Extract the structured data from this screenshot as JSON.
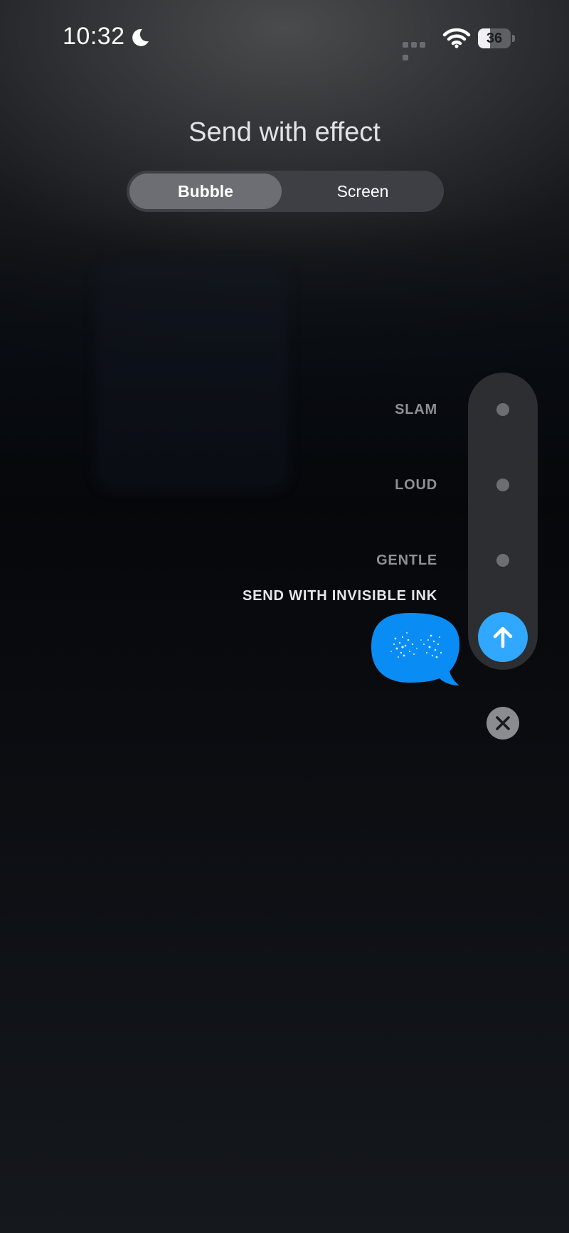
{
  "status_bar": {
    "time": "10:32",
    "focus_icon": "moon-icon",
    "battery": 36,
    "battery_label": "36"
  },
  "header": {
    "title": "Send with effect",
    "tabs": [
      {
        "label": "Bubble",
        "selected": true
      },
      {
        "label": "Screen",
        "selected": false
      }
    ]
  },
  "effects": {
    "slam": "SLAM",
    "loud": "LOUD",
    "gentle": "GENTLE",
    "invisible_ink": "SEND WITH INVISIBLE INK"
  },
  "colors": {
    "accent": "#31a8ff",
    "rail": "#2c2e32",
    "label_inactive": "#8e9094",
    "label_active": "#e4e6ea"
  },
  "icons": {
    "send": "arrow-up-icon",
    "close": "close-icon",
    "wifi": "wifi-icon",
    "cellular": "cellular-signal-icon"
  }
}
